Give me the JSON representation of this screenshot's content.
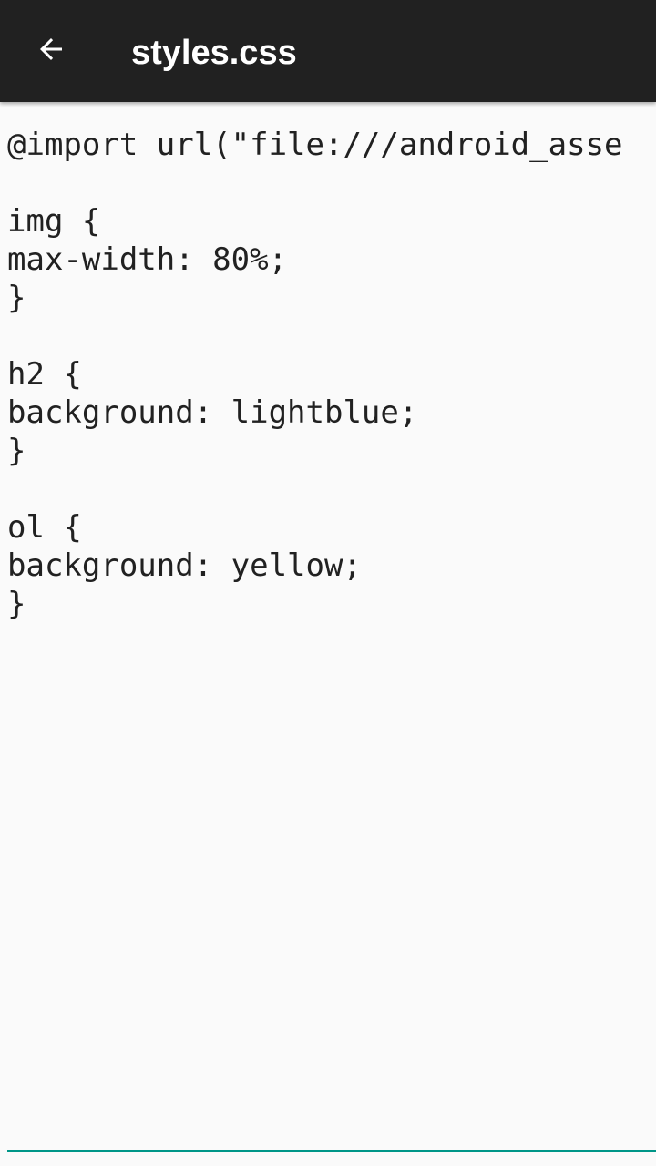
{
  "toolbar": {
    "title": "styles.css",
    "back_icon": "arrow-left-icon",
    "background": "#212121"
  },
  "editor": {
    "lines": [
      "@import url(\"file:///android_asse",
      "",
      "img {",
      "max-width: 80%;",
      "}",
      "",
      "h2 {",
      "background: lightblue;",
      "}",
      "",
      "ol {",
      "background: yellow;",
      "}"
    ],
    "accent_color": "#009688"
  }
}
